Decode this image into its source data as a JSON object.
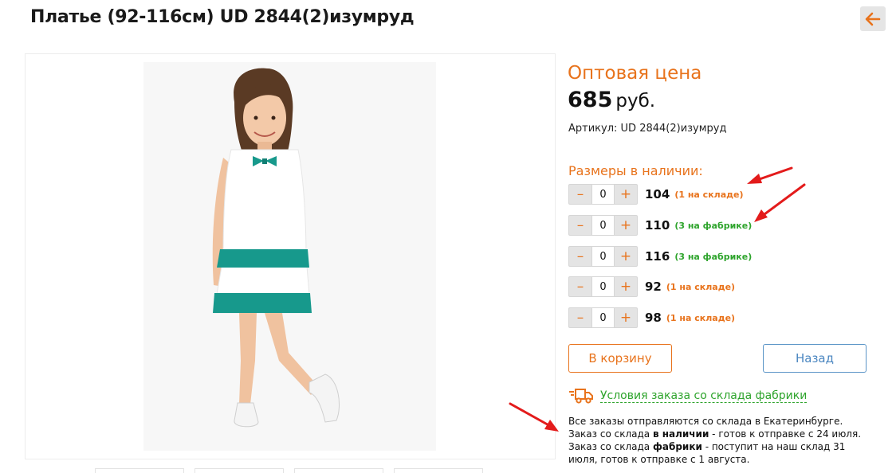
{
  "product": {
    "title": "Платье (92-116см) UD 2844(2)изумруд"
  },
  "price": {
    "label": "Оптовая цена",
    "value": "685",
    "currency": "руб.",
    "sku": "Артикул: UD 2844(2)изумруд"
  },
  "sizes": {
    "title": "Размеры в наличии:",
    "items": [
      {
        "size": "104",
        "qty": "0",
        "stock": "(1 на складе)",
        "stock_type": "warehouse"
      },
      {
        "size": "110",
        "qty": "0",
        "stock": "(3 на фабрике)",
        "stock_type": "factory"
      },
      {
        "size": "116",
        "qty": "0",
        "stock": "(3 на фабрике)",
        "stock_type": "factory"
      },
      {
        "size": "92",
        "qty": "0",
        "stock": "(1 на складе)",
        "stock_type": "warehouse"
      },
      {
        "size": "98",
        "qty": "0",
        "stock": "(1 на складе)",
        "stock_type": "warehouse"
      }
    ],
    "minus": "–",
    "plus": "+"
  },
  "buttons": {
    "cart": "В корзину",
    "back": "Назад"
  },
  "conditions": {
    "link": "Условия заказа со склада фабрики",
    "icon": "delivery-truck-icon"
  },
  "info": {
    "line1": "Все заказы отправляются со склада в Екатеринбурге.",
    "line2_a": "Заказ со склада ",
    "line2_b": "в наличии",
    "line2_c": " -  готов к отправке с 24 июля.",
    "line3_a": "Заказ со склада ",
    "line3_b": "фабрики",
    "line3_c": " - поступит на наш склад 31",
    "line4": "июля, готов к отправке с 1 августа."
  },
  "colors": {
    "accent": "#e8731c",
    "green": "#2ea42c",
    "blue": "#4a86c0",
    "dress_teal": "#17998c"
  }
}
